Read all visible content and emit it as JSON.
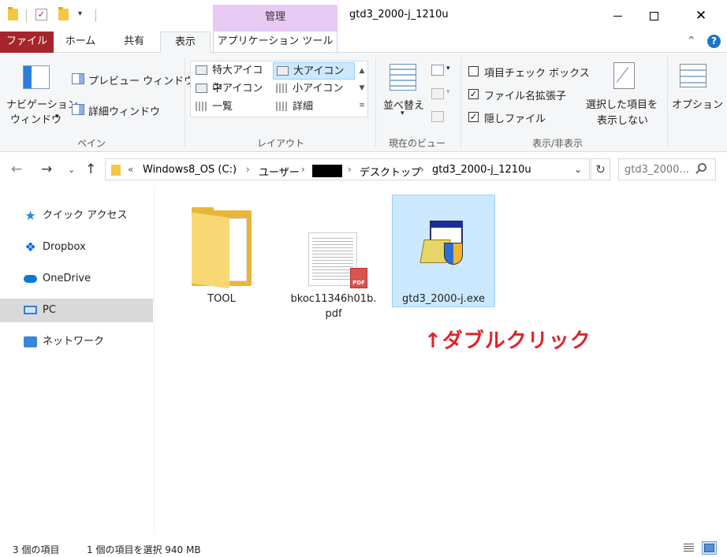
{
  "window": {
    "title": "gtd3_2000-j_1210u",
    "contextual_tab_group": "管理",
    "close_symbol": "✕"
  },
  "tabs": {
    "file": "ファイル",
    "home": "ホーム",
    "share": "共有",
    "view": "表示",
    "app_tools": "アプリケーション ツール"
  },
  "ribbon": {
    "panes": {
      "label": "ペイン",
      "nav_pane_line1": "ナビゲーション",
      "nav_pane_line2": "ウィンドウ",
      "preview_pane": "プレビュー ウィンドウ",
      "details_pane": "詳細ウィンドウ"
    },
    "layout": {
      "label": "レイアウト",
      "items": [
        "特大アイコン",
        "大アイコン",
        "中アイコン",
        "小アイコン",
        "一覧",
        "詳細"
      ],
      "selected": "大アイコン"
    },
    "current_view": {
      "label": "現在のビュー",
      "sort_by": "並べ替え"
    },
    "show_hide": {
      "label": "表示/非表示",
      "item_checkboxes": {
        "label": "項目チェック ボックス",
        "checked": false
      },
      "file_extensions": {
        "label": "ファイル名拡張子",
        "checked": true
      },
      "hidden_items": {
        "label": "隠しファイル",
        "checked": true
      },
      "hide_selected_line1": "選択した項目を",
      "hide_selected_line2": "表示しない"
    },
    "options": "オプション"
  },
  "address": {
    "overflow": "«",
    "crumbs": [
      "Windows8_OS (C:)",
      "ユーザー",
      "デスクトップ",
      "gtd3_2000-j_1210u"
    ],
    "separator": "›",
    "search_placeholder": "gtd3_2000..."
  },
  "sidebar": {
    "items": [
      {
        "label": "クイック アクセス",
        "icon": "star-icon"
      },
      {
        "label": "Dropbox",
        "icon": "dropbox-icon"
      },
      {
        "label": "OneDrive",
        "icon": "onedrive-icon"
      },
      {
        "label": "PC",
        "icon": "pc-icon",
        "selected": true
      },
      {
        "label": "ネットワーク",
        "icon": "network-icon"
      }
    ]
  },
  "files": [
    {
      "name": "TOOL",
      "type": "folder"
    },
    {
      "name_line1": "bkoc11346h01b.",
      "name_line2": "pdf",
      "type": "pdf",
      "badge": "PDF"
    },
    {
      "name": "gtd3_2000-j.exe",
      "type": "exe",
      "selected": true
    }
  ],
  "annotation": "↑ダブルクリック",
  "status": {
    "item_count": "3 個の項目",
    "selection": "1 個の項目を選択  940 MB"
  },
  "colors": {
    "file_tab": "#a4262c",
    "manage_tab": "#e8c9f4",
    "selection": "#cce8ff",
    "annotation": "#e0232a"
  }
}
